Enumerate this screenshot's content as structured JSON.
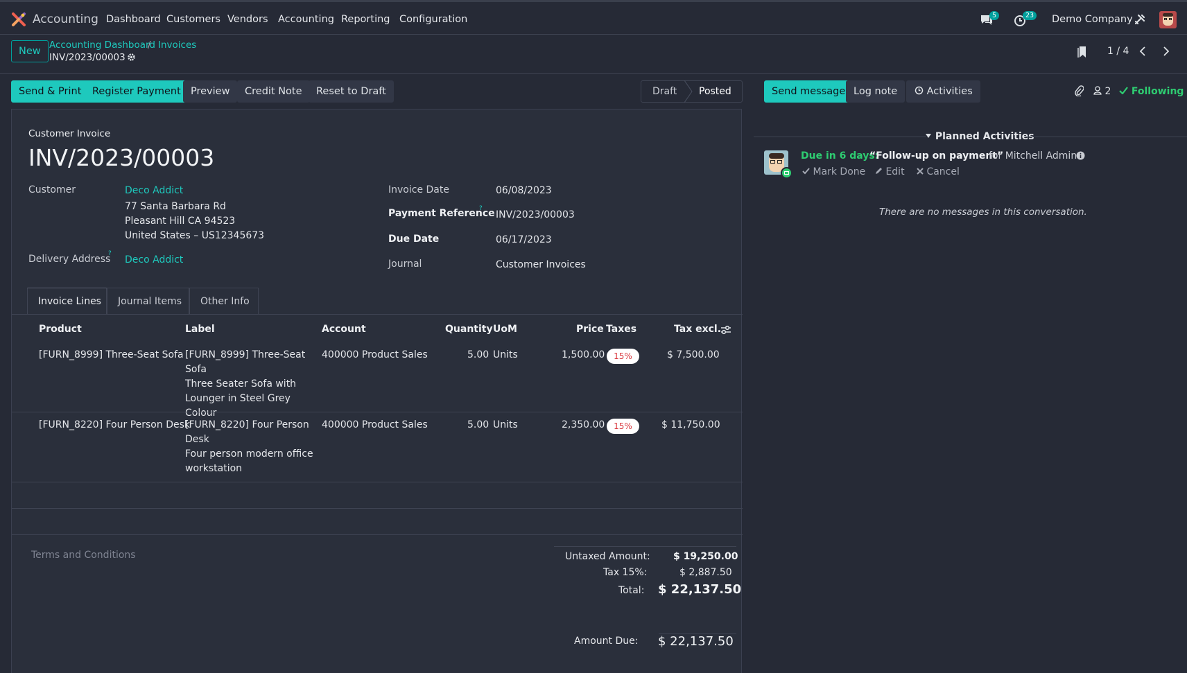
{
  "navbar": {
    "app_name": "Accounting",
    "menu": [
      "Dashboard",
      "Customers",
      "Vendors",
      "Accounting",
      "Reporting",
      "Configuration"
    ],
    "messages_count": "5",
    "activities_count": "23",
    "company": "Demo Company",
    "icons": [
      "chat-icon",
      "clock-icon",
      "tools-icon",
      "avatar"
    ]
  },
  "control_panel": {
    "new_label": "New",
    "breadcrumb_parent": "Accounting Dashboard",
    "breadcrumb_sep": "/",
    "breadcrumb_current": "Invoices",
    "record_name": "INV/2023/00003",
    "pager": "1 / 4"
  },
  "actions": {
    "send_print": "Send & Print",
    "register_payment": "Register Payment",
    "preview": "Preview",
    "credit_note": "Credit Note",
    "reset_draft": "Reset to Draft",
    "status_draft": "Draft",
    "status_posted": "Posted"
  },
  "invoice": {
    "type": "Customer Invoice",
    "number": "INV/2023/00003",
    "customer_label": "Customer",
    "customer_name": "Deco Addict",
    "address_line1": "77 Santa Barbara Rd",
    "address_line2": "Pleasant Hill CA 94523",
    "address_line3": "United States – US12345673",
    "delivery_label": "Delivery Address",
    "delivery_name": "Deco Addict",
    "invoice_date_label": "Invoice Date",
    "invoice_date": "06/08/2023",
    "payment_ref_label": "Payment Reference",
    "payment_ref": "INV/2023/00003",
    "due_date_label": "Due Date",
    "due_date": "06/17/2023",
    "journal_label": "Journal",
    "journal": "Customer Invoices",
    "help_mark": "?"
  },
  "tabs": [
    "Invoice Lines",
    "Journal Items",
    "Other Info"
  ],
  "lines": {
    "headers": {
      "product": "Product",
      "label": "Label",
      "account": "Account",
      "quantity": "Quantity",
      "uom": "UoM",
      "price": "Price",
      "taxes": "Taxes",
      "tax_excl": "Tax excl."
    },
    "rows": [
      {
        "product": "[FURN_8999] Three-Seat Sofa",
        "label1": "[FURN_8999] Three-Seat",
        "label2": "Sofa",
        "label3": "Three Seater Sofa with",
        "label4": "Lounger in Steel Grey Colour",
        "account": "400000 Product Sales",
        "quantity": "5.00",
        "uom": "Units",
        "price": "1,500.00",
        "tax": "15%",
        "subtotal": "$ 7,500.00"
      },
      {
        "product": "[FURN_8220] Four Person Desk",
        "label1": "[FURN_8220] Four Person",
        "label2": "Desk",
        "label3": "Four person modern office",
        "label4": "workstation",
        "account": "400000 Product Sales",
        "quantity": "5.00",
        "uom": "Units",
        "price": "2,350.00",
        "tax": "15%",
        "subtotal": "$ 11,750.00"
      }
    ]
  },
  "terms_placeholder": "Terms and Conditions",
  "totals": {
    "untaxed_label": "Untaxed Amount:",
    "untaxed": "$ 19,250.00",
    "tax_label": "Tax 15%:",
    "tax": "$ 2,887.50",
    "total_label": "Total:",
    "total": "$ 22,137.50",
    "due_label": "Amount Due:",
    "due": "$ 22,137.50"
  },
  "chatter": {
    "send_message": "Send message",
    "log_note": "Log note",
    "activities": "Activities",
    "followers_count": "2",
    "following": "Following",
    "planned_title": "Planned Activities",
    "due_text": "Due in 6 days:",
    "activity_summary": "“Follow-up on payment”",
    "assigned": "for Mitchell Admin",
    "mark_done": "Mark Done",
    "edit": "Edit",
    "cancel": "Cancel",
    "empty": "There are no messages in this conversation."
  },
  "colors": {
    "accent": "#00a09d",
    "accent_light": "#1ec9bd",
    "due_green": "#2ecc71",
    "tax_red": "#d9383e"
  }
}
